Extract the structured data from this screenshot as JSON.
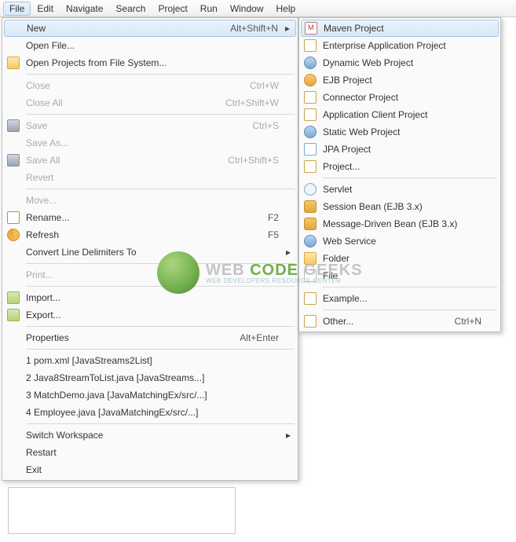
{
  "menubar": [
    "File",
    "Edit",
    "Navigate",
    "Search",
    "Project",
    "Run",
    "Window",
    "Help"
  ],
  "fileMenu": {
    "groups": [
      [
        {
          "label": "New",
          "accel": "Alt+Shift+N",
          "arrow": true,
          "highlight": true
        },
        {
          "label": "Open File..."
        },
        {
          "label": "Open Projects from File System...",
          "icon": "folder"
        }
      ],
      [
        {
          "label": "Close",
          "accel": "Ctrl+W",
          "disabled": true
        },
        {
          "label": "Close All",
          "accel": "Ctrl+Shift+W",
          "disabled": true
        }
      ],
      [
        {
          "label": "Save",
          "accel": "Ctrl+S",
          "icon": "save",
          "disabled": true
        },
        {
          "label": "Save As...",
          "disabled": true
        },
        {
          "label": "Save All",
          "accel": "Ctrl+Shift+S",
          "icon": "save",
          "disabled": true
        },
        {
          "label": "Revert",
          "disabled": true
        }
      ],
      [
        {
          "label": "Move...",
          "disabled": true
        },
        {
          "label": "Rename...",
          "accel": "F2",
          "icon": "rename"
        },
        {
          "label": "Refresh",
          "accel": "F5",
          "icon": "refresh"
        },
        {
          "label": "Convert Line Delimiters To",
          "arrow": true
        }
      ],
      [
        {
          "label": "Print...",
          "disabled": true
        }
      ],
      [
        {
          "label": "Import...",
          "icon": "import"
        },
        {
          "label": "Export...",
          "icon": "export"
        }
      ],
      [
        {
          "label": "Properties",
          "accel": "Alt+Enter"
        }
      ],
      [
        {
          "label": "1 pom.xml  [JavaStreams2List]"
        },
        {
          "label": "2 Java8StreamToList.java  [JavaStreams...]"
        },
        {
          "label": "3 MatchDemo.java  [JavaMatchingEx/src/...]"
        },
        {
          "label": "4 Employee.java  [JavaMatchingEx/src/...]"
        }
      ],
      [
        {
          "label": "Switch Workspace",
          "arrow": true
        },
        {
          "label": "Restart"
        },
        {
          "label": "Exit"
        }
      ]
    ]
  },
  "newMenu": {
    "groups": [
      [
        {
          "label": "Maven Project",
          "icon": "maven",
          "highlight": true
        },
        {
          "label": "Enterprise Application Project",
          "icon": "proj"
        },
        {
          "label": "Dynamic Web Project",
          "icon": "web"
        },
        {
          "label": "EJB Project",
          "icon": "ejb"
        },
        {
          "label": "Connector Project",
          "icon": "proj"
        },
        {
          "label": "Application Client Project",
          "icon": "proj"
        },
        {
          "label": "Static Web Project",
          "icon": "web"
        },
        {
          "label": "JPA Project",
          "icon": "jpa"
        },
        {
          "label": "Project...",
          "icon": "other"
        }
      ],
      [
        {
          "label": "Servlet",
          "icon": "servlet"
        },
        {
          "label": "Session Bean (EJB 3.x)",
          "icon": "bean"
        },
        {
          "label": "Message-Driven Bean (EJB 3.x)",
          "icon": "bean"
        },
        {
          "label": "Web Service",
          "icon": "web"
        },
        {
          "label": "Folder",
          "icon": "folder"
        },
        {
          "label": "File",
          "icon": "file"
        }
      ],
      [
        {
          "label": "Example...",
          "icon": "other"
        }
      ],
      [
        {
          "label": "Other...",
          "accel": "Ctrl+N",
          "icon": "other"
        }
      ]
    ]
  },
  "watermark": {
    "title_a": "WEB ",
    "title_b": "CODE ",
    "title_c": "GEEKS",
    "sub": "WEB DEVELOPERS RESOURCE CENTER"
  }
}
